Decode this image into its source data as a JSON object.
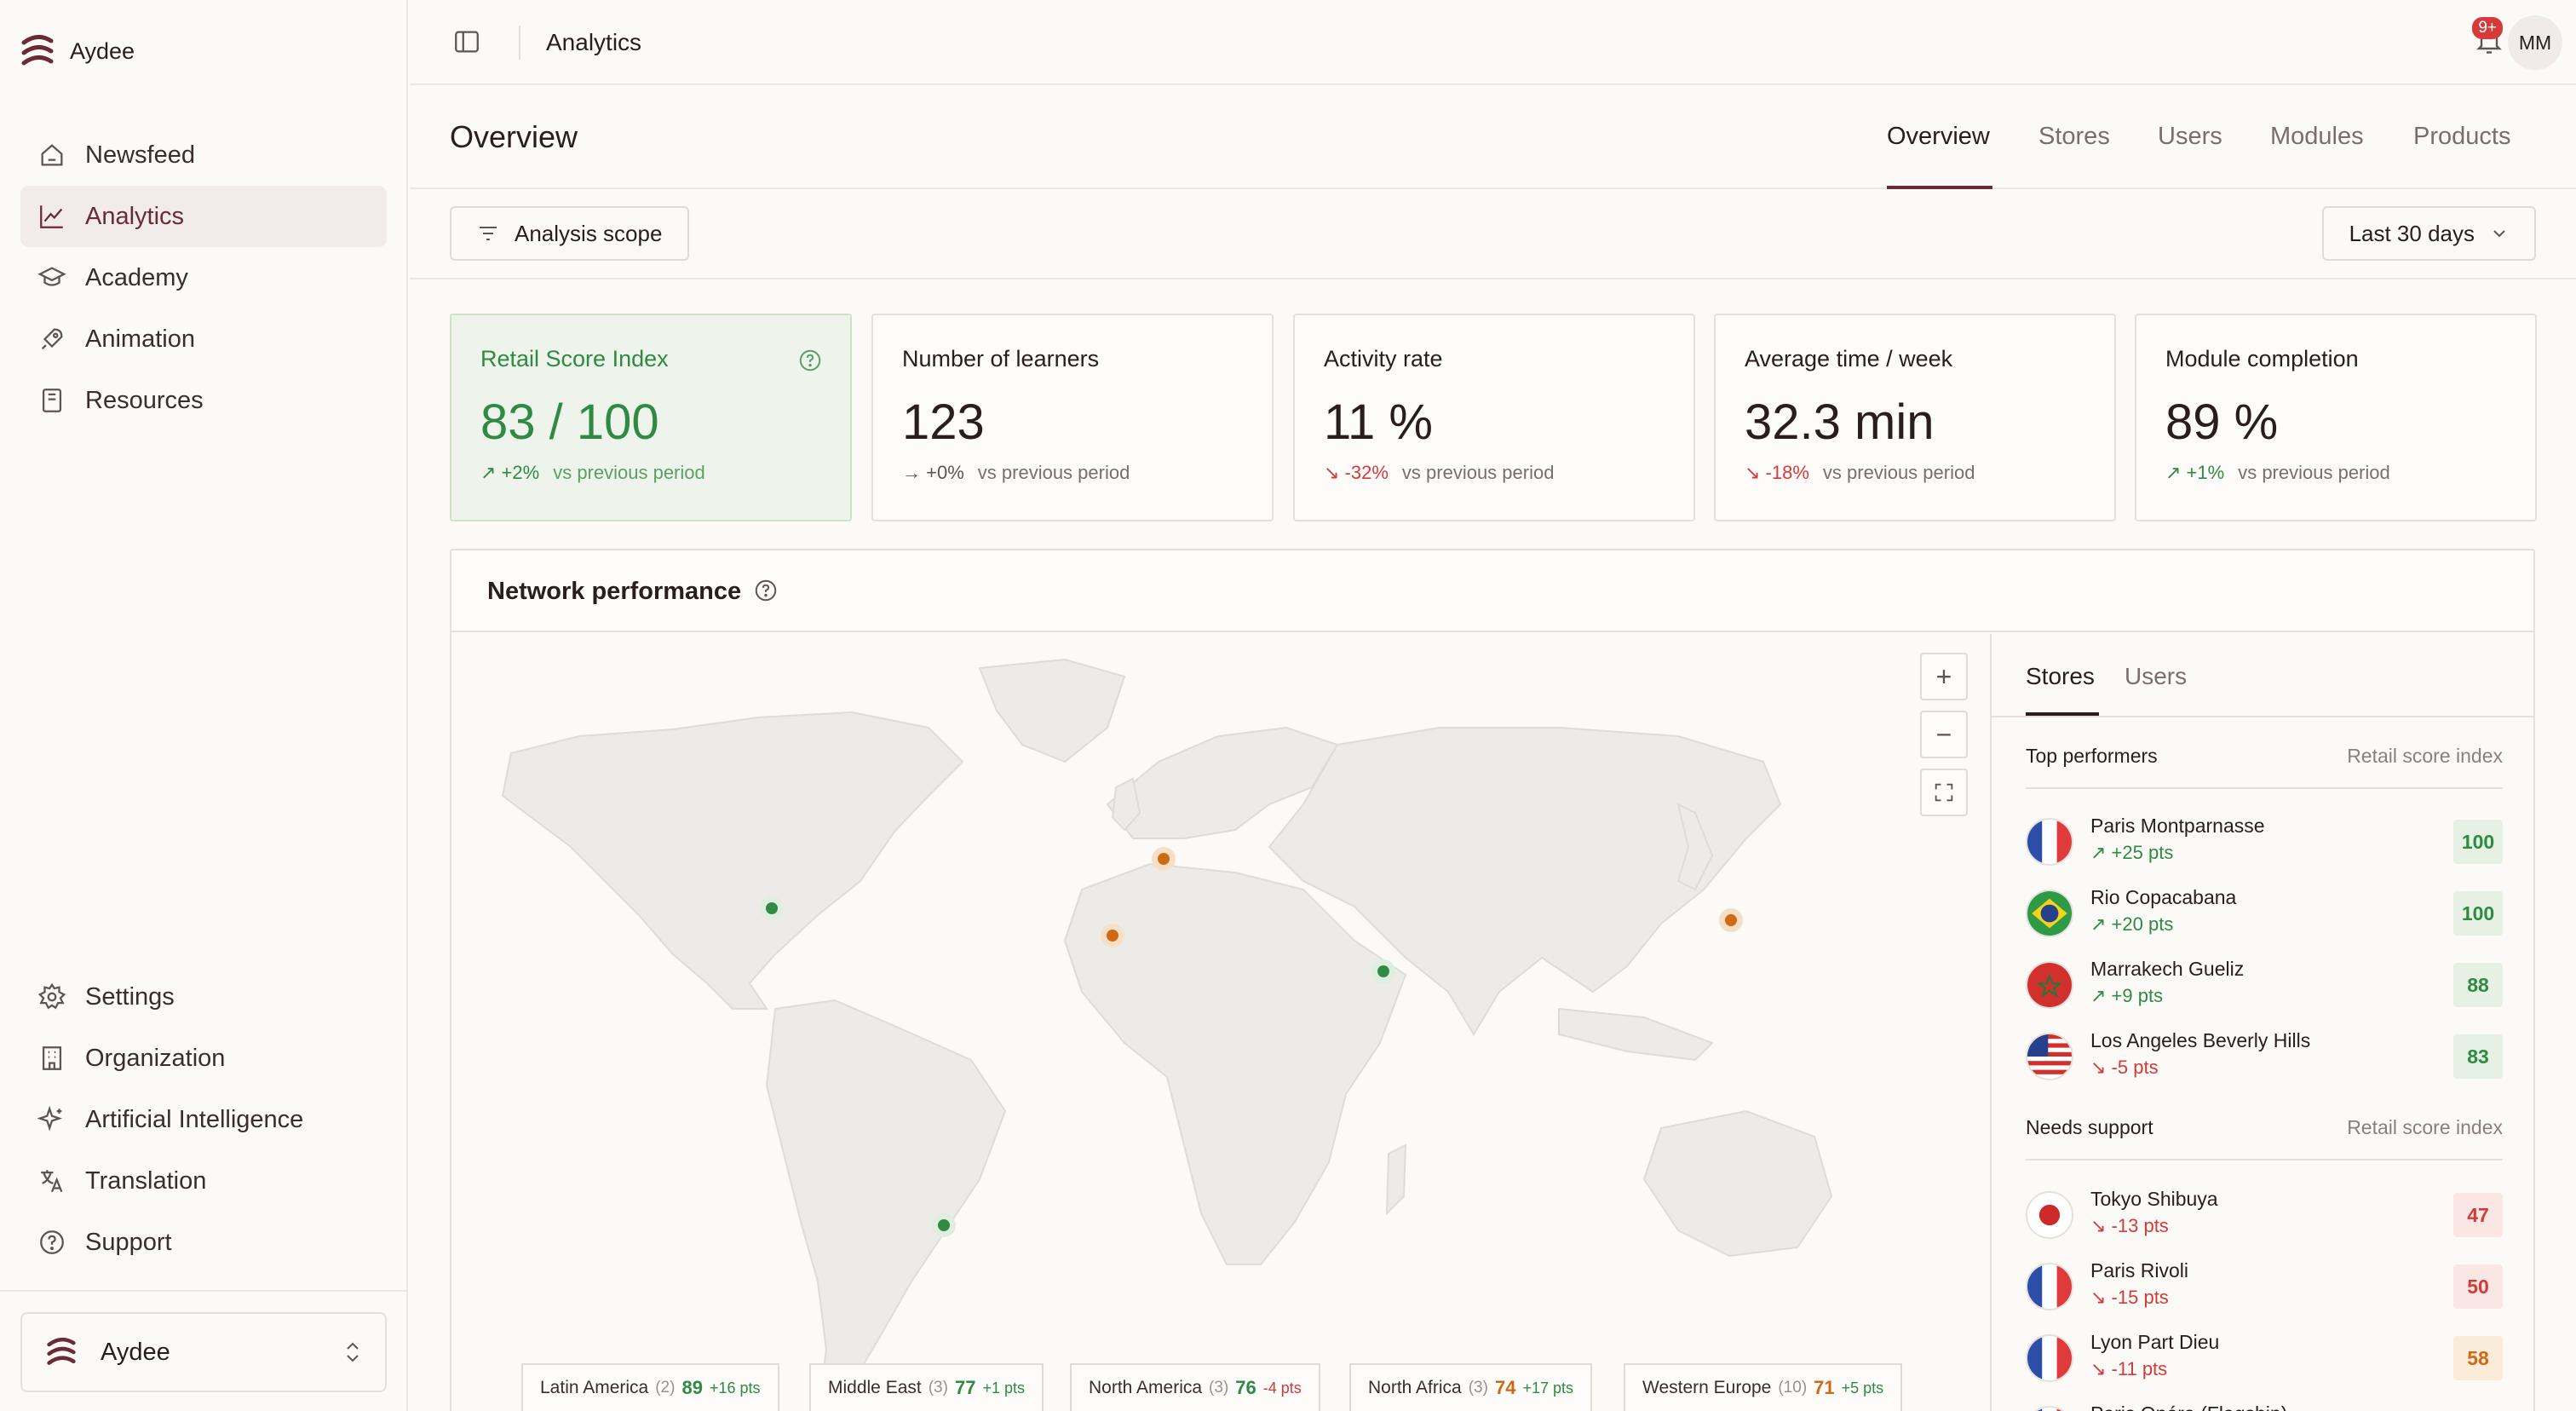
{
  "app": {
    "name": "Aydee"
  },
  "sidebar": {
    "nav_top": [
      {
        "label": "Newsfeed",
        "icon": "home-icon"
      },
      {
        "label": "Analytics",
        "icon": "chart-line-icon",
        "active": true
      },
      {
        "label": "Academy",
        "icon": "graduation-cap-icon"
      },
      {
        "label": "Animation",
        "icon": "rocket-icon"
      },
      {
        "label": "Resources",
        "icon": "book-icon"
      }
    ],
    "nav_bottom": [
      {
        "label": "Settings",
        "icon": "gear-icon"
      },
      {
        "label": "Organization",
        "icon": "building-icon"
      },
      {
        "label": "Artificial Intelligence",
        "icon": "sparkles-icon"
      },
      {
        "label": "Translation",
        "icon": "translate-icon"
      },
      {
        "label": "Support",
        "icon": "help-circle-icon"
      }
    ],
    "org_switcher": {
      "name": "Aydee"
    }
  },
  "topbar": {
    "breadcrumb": "Analytics",
    "notifications_badge": "9+",
    "user_initials": "MM"
  },
  "page": {
    "title": "Overview",
    "tabs": [
      {
        "label": "Overview",
        "active": true
      },
      {
        "label": "Stores"
      },
      {
        "label": "Users"
      },
      {
        "label": "Modules"
      },
      {
        "label": "Products"
      }
    ]
  },
  "filters": {
    "scope_button": "Analysis scope",
    "period_select": "Last 30 days"
  },
  "kpis": [
    {
      "label": "Retail Score Index",
      "value": "83 / 100",
      "delta": "+2%",
      "trend": "up",
      "note": "vs previous period",
      "highlight": true
    },
    {
      "label": "Number of learners",
      "value": "123",
      "delta": "+0%",
      "trend": "flat",
      "note": "vs previous period"
    },
    {
      "label": "Activity rate",
      "value": "11 %",
      "delta": "-32%",
      "trend": "down",
      "note": "vs previous period"
    },
    {
      "label": "Average time / week",
      "value": "32.3 min",
      "delta": "-18%",
      "trend": "down",
      "note": "vs previous period"
    },
    {
      "label": "Module completion",
      "value": "89 %",
      "delta": "+1%",
      "trend": "up",
      "note": "vs previous period"
    }
  ],
  "network": {
    "title": "Network performance",
    "map_controls": {
      "zoom_in": "+",
      "zoom_out": "−"
    },
    "regions": [
      {
        "name": "Latin America",
        "count": "(2)",
        "score": "89",
        "delta": "+16 pts",
        "color": "green"
      },
      {
        "name": "Middle East",
        "count": "(3)",
        "score": "77",
        "delta": "+1 pts",
        "color": "green"
      },
      {
        "name": "North America",
        "count": "(3)",
        "score": "76",
        "delta": "-4 pts",
        "color": "green"
      },
      {
        "name": "North Africa",
        "count": "(3)",
        "score": "74",
        "delta": "+17 pts",
        "color": "orange"
      },
      {
        "name": "Western Europe",
        "count": "(10)",
        "score": "71",
        "delta": "+5 pts",
        "color": "orange"
      }
    ],
    "list_tabs": [
      {
        "label": "Stores",
        "active": true
      },
      {
        "label": "Users"
      }
    ],
    "top_performers": {
      "title": "Top performers",
      "metric": "Retail score index",
      "items": [
        {
          "name": "Paris Montparnasse",
          "delta": "+25 pts",
          "trend": "up",
          "score": "100",
          "flag": "fr"
        },
        {
          "name": "Rio Copacabana",
          "delta": "+20 pts",
          "trend": "up",
          "score": "100",
          "flag": "br"
        },
        {
          "name": "Marrakech Gueliz",
          "delta": "+9 pts",
          "trend": "up",
          "score": "88",
          "flag": "ma"
        },
        {
          "name": "Los Angeles Beverly Hills",
          "delta": "-5 pts",
          "trend": "down",
          "score": "83",
          "flag": "us"
        }
      ]
    },
    "needs_support": {
      "title": "Needs support",
      "metric": "Retail score index",
      "items": [
        {
          "name": "Tokyo Shibuya",
          "delta": "-13 pts",
          "trend": "down",
          "score": "47",
          "flag": "jp",
          "chip": "red"
        },
        {
          "name": "Paris Rivoli",
          "delta": "-15 pts",
          "trend": "down",
          "score": "50",
          "flag": "fr",
          "chip": "red"
        },
        {
          "name": "Lyon Part Dieu",
          "delta": "-11 pts",
          "trend": "down",
          "score": "58",
          "flag": "fr",
          "chip": "orange"
        },
        {
          "name": "Paris Opéra (Flagship)",
          "flag": "fr"
        }
      ]
    }
  }
}
